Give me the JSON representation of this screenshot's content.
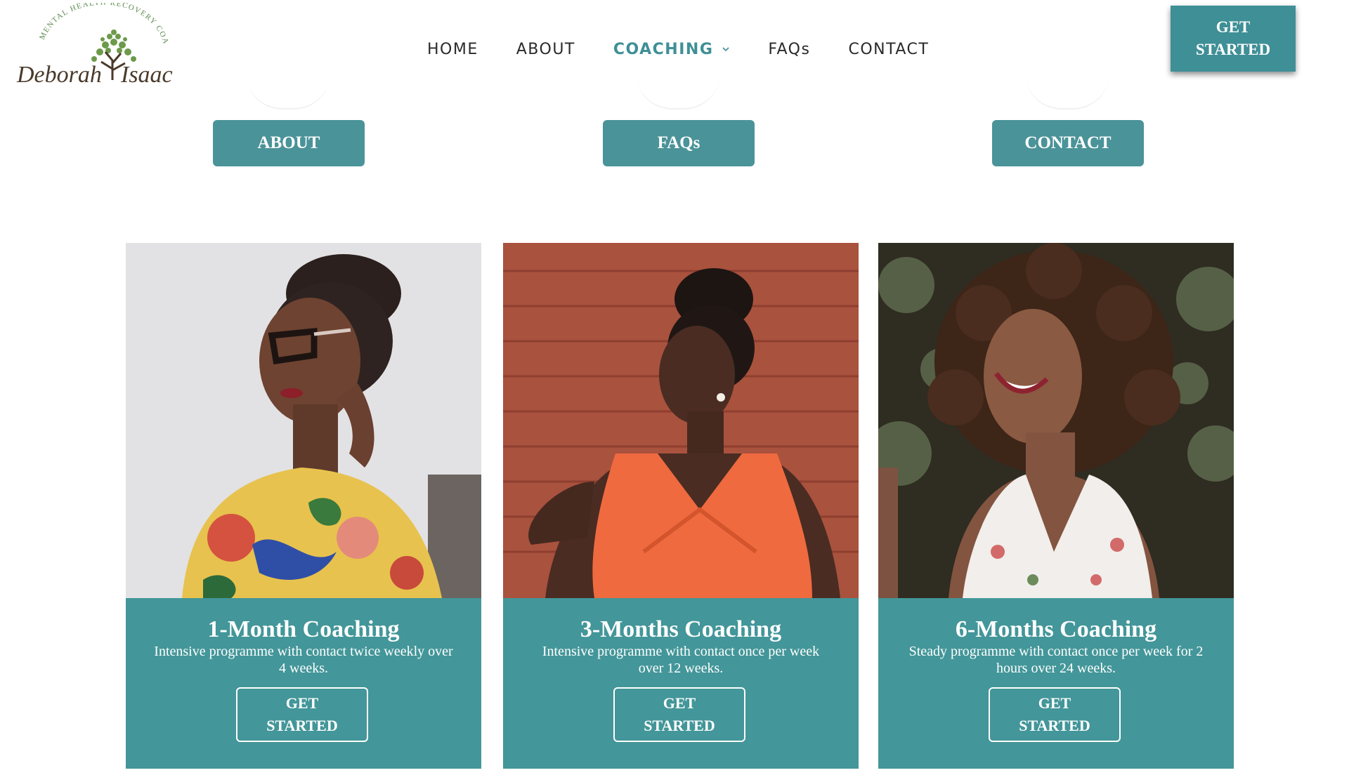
{
  "brand": {
    "name": "Deborah Isaac",
    "tagline": "MENTAL HEALTH RECOVERY COACH"
  },
  "nav": {
    "items": [
      {
        "label": "HOME"
      },
      {
        "label": "ABOUT"
      },
      {
        "label": "COACHING",
        "active": true,
        "has_dropdown": true
      },
      {
        "label": "FAQs"
      },
      {
        "label": "CONTACT"
      }
    ],
    "cta_label": "GET\nSTARTED"
  },
  "quick_links": [
    {
      "label": "ABOUT"
    },
    {
      "label": "FAQs"
    },
    {
      "label": "CONTACT"
    }
  ],
  "cards": [
    {
      "title": "1-Month Coaching",
      "description": "Intensive programme with contact twice weekly over 4 weeks.",
      "button": "GET\nSTARTED",
      "image": "woman-in-glasses-floral-top-photo"
    },
    {
      "title": "3-Months Coaching",
      "description": "Intensive programme with contact once per week over 12 weeks.",
      "button": "GET\nSTARTED",
      "image": "woman-in-orange-dress-brick-wall-photo"
    },
    {
      "title": "6-Months Coaching",
      "description": "Steady programme with contact once per week for 2 hours over 24 weeks.",
      "button": "GET\nSTARTED",
      "image": "smiling-woman-curly-hair-photo"
    }
  ],
  "colors": {
    "teal": "#439699",
    "nav_active": "#3f8f96",
    "text_dark": "#2a2a2a"
  }
}
